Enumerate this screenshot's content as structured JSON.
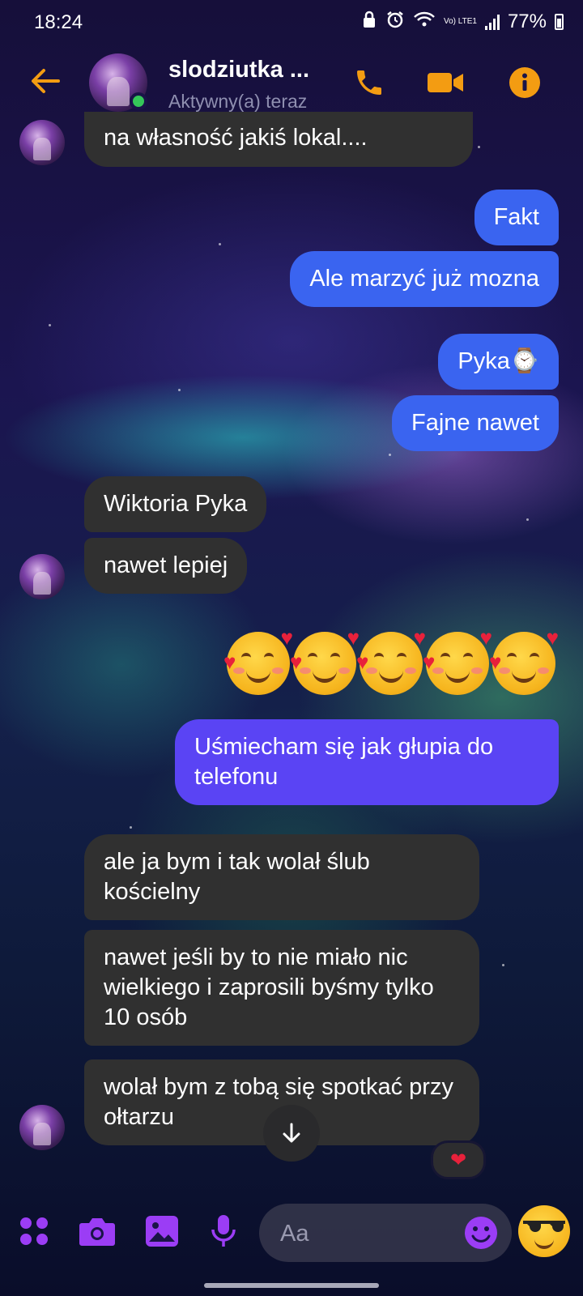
{
  "status_bar": {
    "time": "18:24",
    "battery": "77%",
    "network_label": "Vo) LTE1",
    "icons": [
      "lock-icon",
      "alarm-icon",
      "wifi-icon",
      "signal-icon",
      "battery-icon"
    ]
  },
  "header": {
    "contact_name": "slodziutka ...",
    "contact_status": "Aktywny(a) teraz",
    "accent_color": "#f39c12",
    "buttons": [
      "back-arrow-icon",
      "phone-icon",
      "video-icon",
      "info-icon"
    ]
  },
  "messages": [
    {
      "id": "m1",
      "side": "in",
      "text": "na własność jakiś lokal...."
    },
    {
      "id": "m2",
      "side": "out",
      "text": "Fakt"
    },
    {
      "id": "m3",
      "side": "out",
      "text": "Ale marzyć już mozna"
    },
    {
      "id": "m4",
      "side": "out",
      "text": "Pyka⌚"
    },
    {
      "id": "m5",
      "side": "out",
      "text": "Fajne nawet"
    },
    {
      "id": "m6",
      "side": "in",
      "text": "Wiktoria Pyka"
    },
    {
      "id": "m7",
      "side": "in",
      "text": "nawet lepiej"
    },
    {
      "id": "m8",
      "side": "out",
      "emoji_count": 5,
      "emoji": "smiling-face-with-hearts"
    },
    {
      "id": "m9",
      "side": "out",
      "text": "Uśmiecham się jak głupia do telefonu"
    },
    {
      "id": "m10",
      "side": "in",
      "text": "ale ja bym i tak wolał ślub kościelny"
    },
    {
      "id": "m11",
      "side": "in",
      "text": "nawet jeśli by to nie miało nic wielkiego i zaprosili byśmy tylko 10 osób"
    },
    {
      "id": "m12",
      "side": "in",
      "text": "wolał bym z tobą się spotkać przy ołtarzu",
      "reaction": "❤"
    }
  ],
  "composer": {
    "placeholder": "Aa",
    "icons": [
      "apps-grid-icon",
      "camera-icon",
      "gallery-icon",
      "microphone-icon",
      "emoji-icon",
      "cool-emoji-icon"
    ],
    "accent_color": "#9b3df5"
  },
  "colors": {
    "incoming_bubble": "#303030",
    "outgoing_bubble": "#3a64f0",
    "outgoing_bubble_latest": "#5a44f4"
  }
}
